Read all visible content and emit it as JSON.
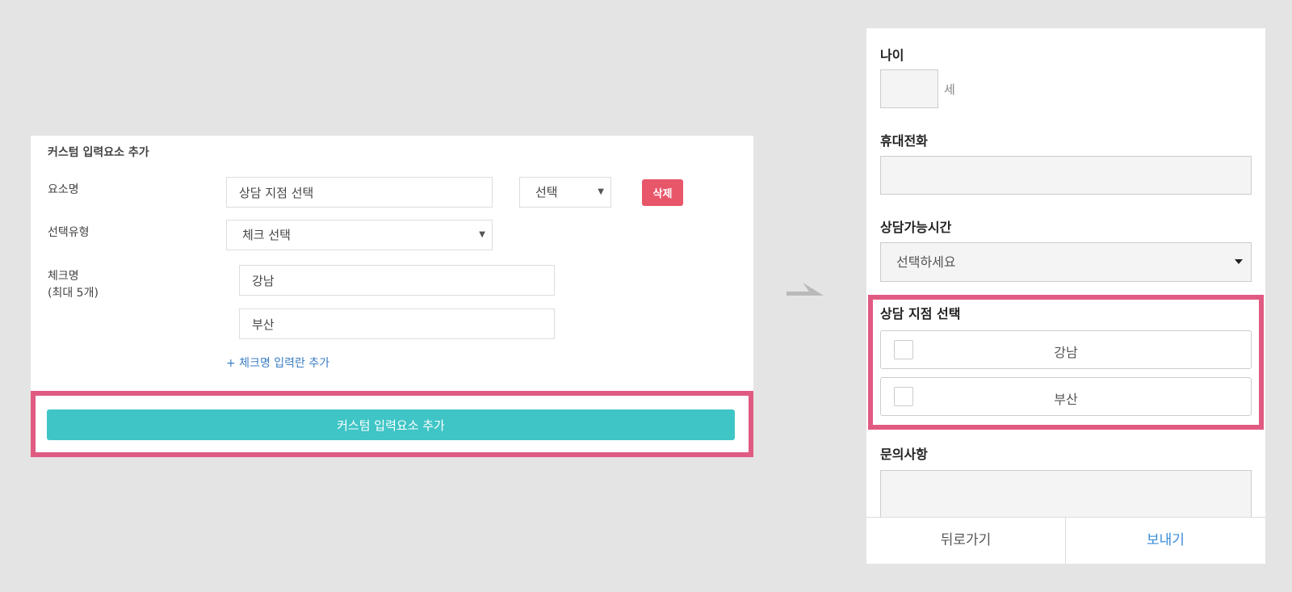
{
  "editor": {
    "title": "커스텀 입력요소 추가",
    "element_name_label": "요소명",
    "element_name_value": "상담 지점 선택",
    "type_select_value": "선택",
    "delete_label": "삭제",
    "select_type_label": "선택유형",
    "select_type_value": "체크 선택",
    "check_name_label": "체크명",
    "check_name_sublabel": "(최대 5개)",
    "check_items": [
      "강남",
      "부산"
    ],
    "add_check_link": "+ 체크명 입력란 추가",
    "add_custom_button": "커스텀 입력요소 추가"
  },
  "preview": {
    "age_label": "나이",
    "age_unit": "세",
    "phone_label": "휴대전화",
    "time_label": "상담가능시간",
    "time_placeholder": "선택하세요",
    "branch_label": "상담 지점 선택",
    "branch_options": [
      "강남",
      "부산"
    ],
    "inquiry_label": "문의사항",
    "back_button": "뒤로가기",
    "send_button": "보내기"
  },
  "colors": {
    "highlight": "#e05a82",
    "add_button": "#3fc5c6",
    "delete_button": "#e8566a",
    "send_text": "#3a8cd6"
  }
}
